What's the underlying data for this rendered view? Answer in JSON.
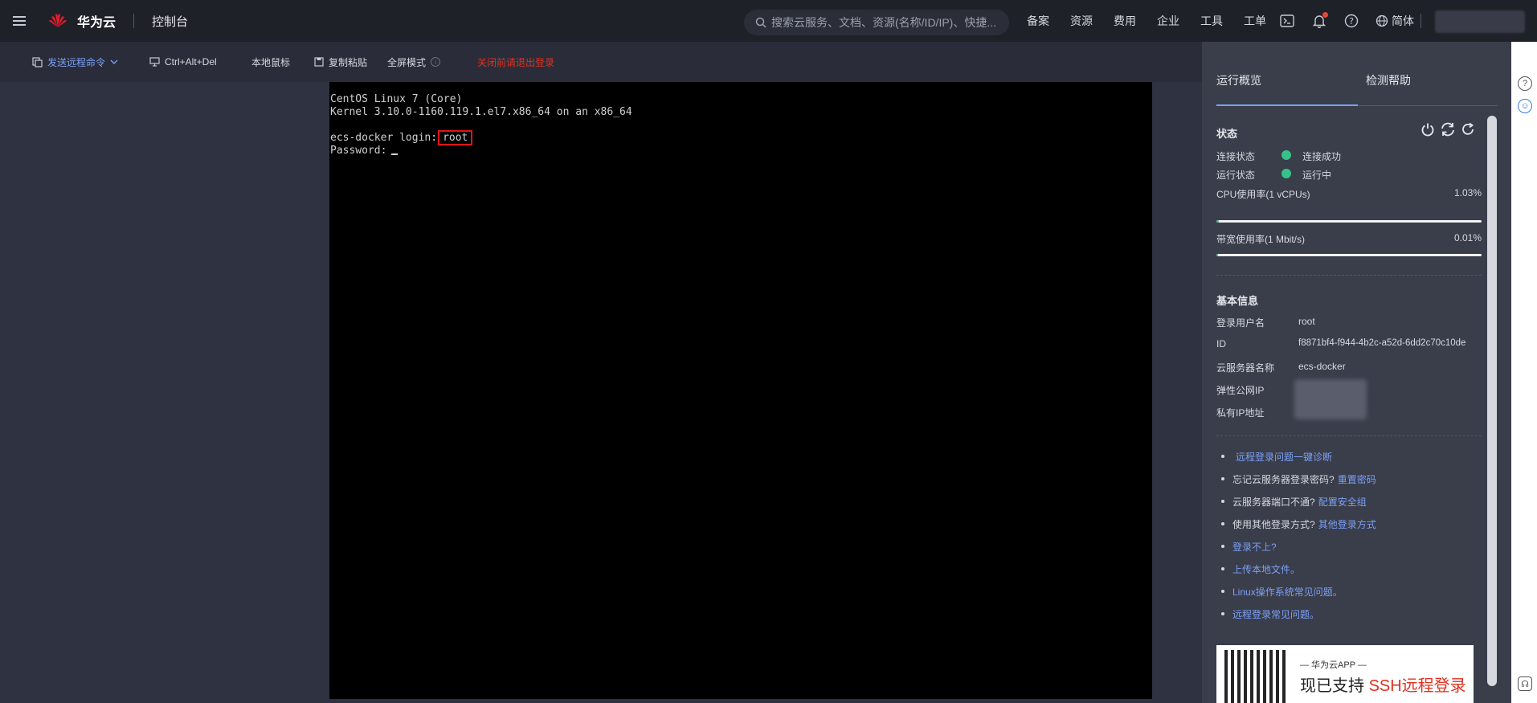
{
  "topbar": {
    "brand": "华为云",
    "brand_small": "HUAWEI",
    "console": "控制台",
    "search_placeholder": "搜索云服务、文档、资源(名称/ID/IP)、快捷...",
    "links": [
      "备案",
      "资源",
      "费用",
      "企业",
      "工具",
      "工单"
    ],
    "language": "简体"
  },
  "toolbar": {
    "send_command": "发送远程命令",
    "ctrl_alt_del": "Ctrl+Alt+Del",
    "local_mouse": "本地鼠标",
    "copy_paste": "复制粘贴",
    "fullscreen": "全屏模式",
    "warning": "关闭前请退出登录"
  },
  "terminal": {
    "line1": "CentOS Linux 7 (Core)",
    "line2": "Kernel 3.10.0-1160.119.1.el7.x86_64 on an x86_64",
    "login_prompt": "ecs-docker login:",
    "login_value": "root",
    "password_prompt": "Password:"
  },
  "panel": {
    "tabs": [
      "运行概览",
      "检测帮助"
    ],
    "status_title": "状态",
    "connection_label": "连接状态",
    "connection_value": "连接成功",
    "run_label": "运行状态",
    "run_value": "运行中",
    "cpu_label": "CPU使用率(1 vCPUs)",
    "cpu_value": "1.03%",
    "cpu_fraction": 0.0103,
    "bw_label": "带宽使用率(1 Mbit/s)",
    "bw_value": "0.01%",
    "bw_fraction": 0.0001,
    "basic_title": "基本信息",
    "user_label": "登录用户名",
    "user_value": "root",
    "id_label": "ID",
    "id_value": "f8871bf4-f944-4b2c-a52d-6dd2c70c10de",
    "name_label": "云服务器名称",
    "name_value": "ecs-docker",
    "eip_label": "弹性公网IP",
    "private_ip_label": "私有IP地址",
    "help_links": [
      {
        "text": "",
        "link": "远程登录问题一键诊断"
      },
      {
        "text": "忘记云服务器登录密码?",
        "link": "重置密码"
      },
      {
        "text": "云服务器端口不通?",
        "link": "配置安全组"
      },
      {
        "text": "使用其他登录方式?",
        "link": "其他登录方式"
      },
      {
        "text": "",
        "link": "登录不上?"
      },
      {
        "text": "",
        "link": "上传本地文件。"
      },
      {
        "text": "",
        "link": "Linux操作系统常见问题。"
      },
      {
        "text": "",
        "link": "远程登录常见问题。"
      }
    ],
    "promo_sub": "— 华为云APP —",
    "promo_main": "现已支持",
    "promo_highlight": "SSH远程登录"
  },
  "colors": {
    "accent": "#7ba0f5",
    "success": "#36c28a",
    "warning": "#e0301e"
  }
}
